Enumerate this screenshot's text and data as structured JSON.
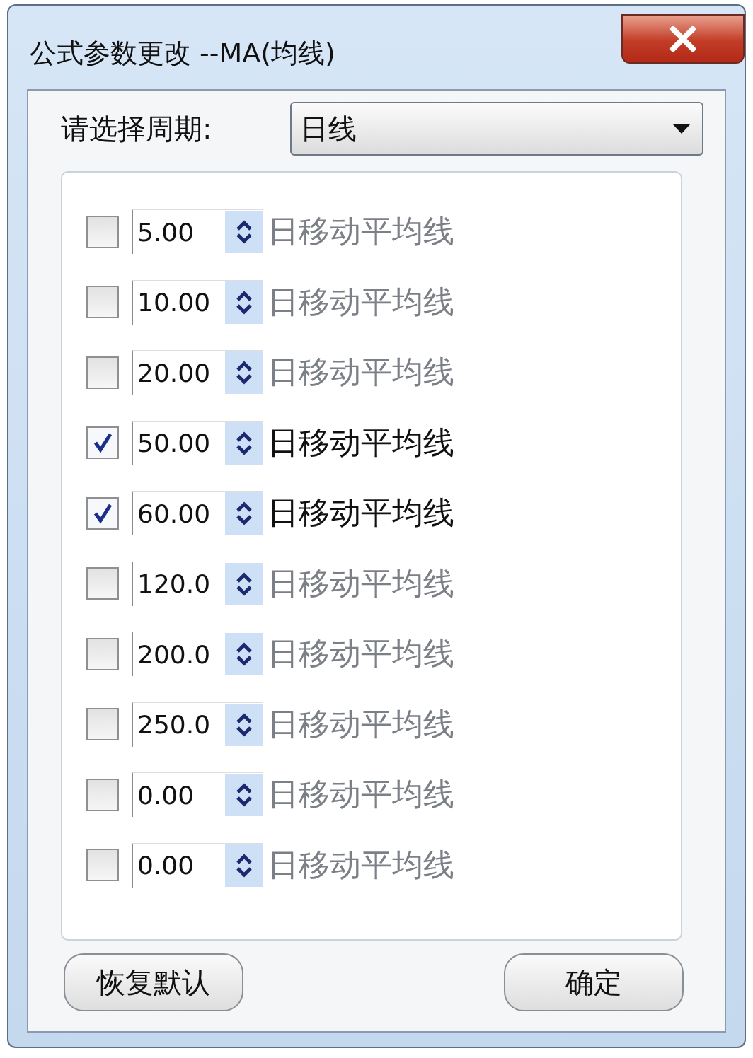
{
  "window": {
    "title": "公式参数更改 --MA(均线)"
  },
  "period": {
    "label": "请选择周期:",
    "value": "日线"
  },
  "rows": [
    {
      "checked": false,
      "value": "5.00",
      "label": "日移动平均线"
    },
    {
      "checked": false,
      "value": "10.00",
      "label": "日移动平均线"
    },
    {
      "checked": false,
      "value": "20.00",
      "label": "日移动平均线"
    },
    {
      "checked": true,
      "value": "50.00",
      "label": "日移动平均线"
    },
    {
      "checked": true,
      "value": "60.00",
      "label": "日移动平均线"
    },
    {
      "checked": false,
      "value": "120.0",
      "label": "日移动平均线"
    },
    {
      "checked": false,
      "value": "200.0",
      "label": "日移动平均线"
    },
    {
      "checked": false,
      "value": "250.0",
      "label": "日移动平均线"
    },
    {
      "checked": false,
      "value": "0.00",
      "label": "日移动平均线"
    },
    {
      "checked": false,
      "value": "0.00",
      "label": "日移动平均线"
    }
  ],
  "buttons": [
    "恢复默认",
    "确定"
  ]
}
